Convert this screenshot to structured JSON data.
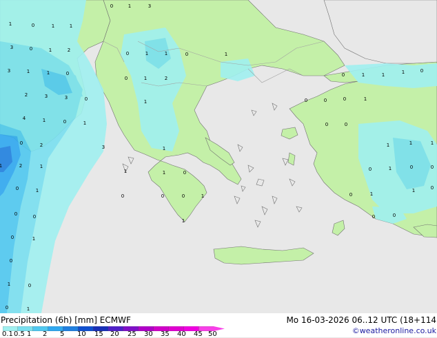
{
  "legend": {
    "title": "Precipitation (6h) [mm] ECMWF",
    "run_info": "Mo 16-03-2026 06..12 UTC (18+114",
    "credit": "©weatheronline.co.uk",
    "ticks": [
      "0.1",
      "0.5",
      "1",
      "2",
      "5",
      "10",
      "15",
      "20",
      "25",
      "30",
      "35",
      "40",
      "45",
      "50"
    ],
    "colors": [
      "#a0f0f0",
      "#7ae0f0",
      "#50c8f0",
      "#30a8f0",
      "#2080e0",
      "#1050d0",
      "#1830b8",
      "#5020c8",
      "#8010c8",
      "#b000c8",
      "#d000c8",
      "#e000d0",
      "#f000e0",
      "#f840e8"
    ]
  },
  "map_colors": {
    "sea": "#e8e8e8",
    "land": "#c4f0a8",
    "border": "#a0a0a0",
    "coast": "#707070"
  },
  "map_values": [
    "0",
    "1",
    "3",
    "1",
    "0",
    "1",
    "1",
    "3",
    "0",
    "1",
    "2",
    "3",
    "1",
    "1",
    "0",
    "2",
    "3",
    "3",
    "0",
    "0",
    "1",
    "1",
    "0",
    "1",
    "0",
    "1",
    "2",
    "4",
    "1",
    "0",
    "1",
    "1",
    "3",
    "1",
    "0",
    "2",
    "1",
    "2",
    "1",
    "1",
    "1",
    "0",
    "0",
    "1",
    "0",
    "0",
    "0",
    "1",
    "0",
    "0",
    "1",
    "0",
    "1",
    "0",
    "1",
    "0",
    "0",
    "1",
    "0",
    "0",
    "0",
    "1",
    "1",
    "1",
    "0",
    "0",
    "1",
    "0",
    "0",
    "1",
    "1",
    "1",
    "0",
    "1",
    "0",
    "0",
    "0",
    "1",
    "1",
    "0",
    "0",
    "0"
  ]
}
